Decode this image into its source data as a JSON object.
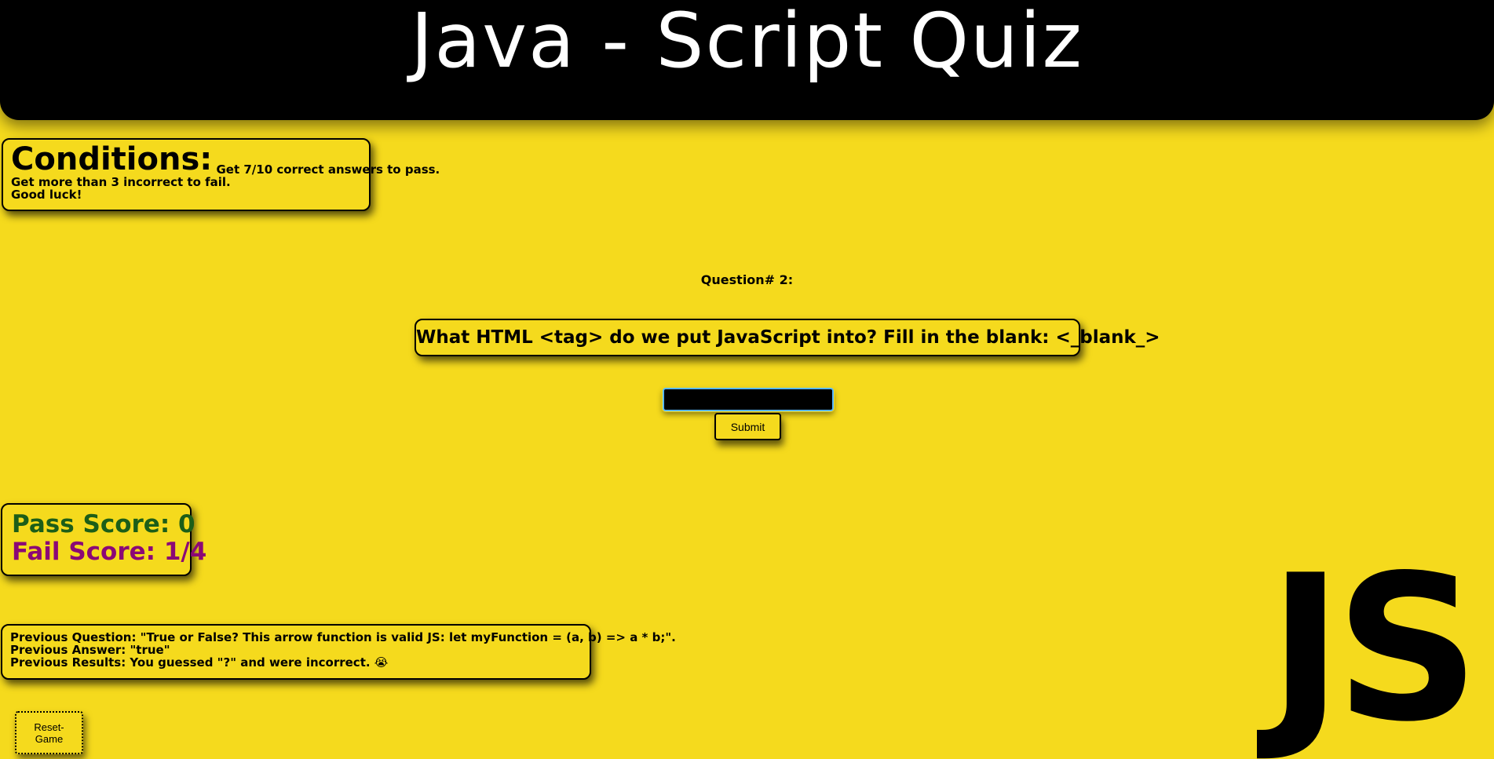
{
  "header": {
    "title": "Java - Script Quiz"
  },
  "conditions": {
    "heading": "Conditions:",
    "line1": "Get 7/10 correct answers to pass.",
    "line2": "Get more than 3 incorrect to fail.",
    "line3": "Good luck!"
  },
  "quiz": {
    "question_number": "Question# 2:",
    "question": "What HTML <tag> do we put JavaScript into? Fill in the blank: <_blank_>",
    "answer_value": "",
    "submit_label": "Submit"
  },
  "scores": {
    "pass": "Pass Score: 0",
    "fail": "Fail Score: 1/4",
    "pass_color": "#1c5e18",
    "fail_color": "#8b0876"
  },
  "previous": {
    "question": "Previous Question: \"True or False? This arrow function is valid JS: let myFunction = (a, b) => a * b;\".",
    "answer": "Previous Answer: \"true\"",
    "results": "Previous Results: You guessed \"?\" and were incorrect. 😭"
  },
  "controls": {
    "reset_label_line1": "Reset-",
    "reset_label_line2": "Game"
  },
  "logo": {
    "text": "JS"
  },
  "theme": {
    "background": "#f5da1d",
    "header_background": "#000000",
    "header_text": "#ffffff",
    "input_focus_border": "#58b7ff"
  }
}
